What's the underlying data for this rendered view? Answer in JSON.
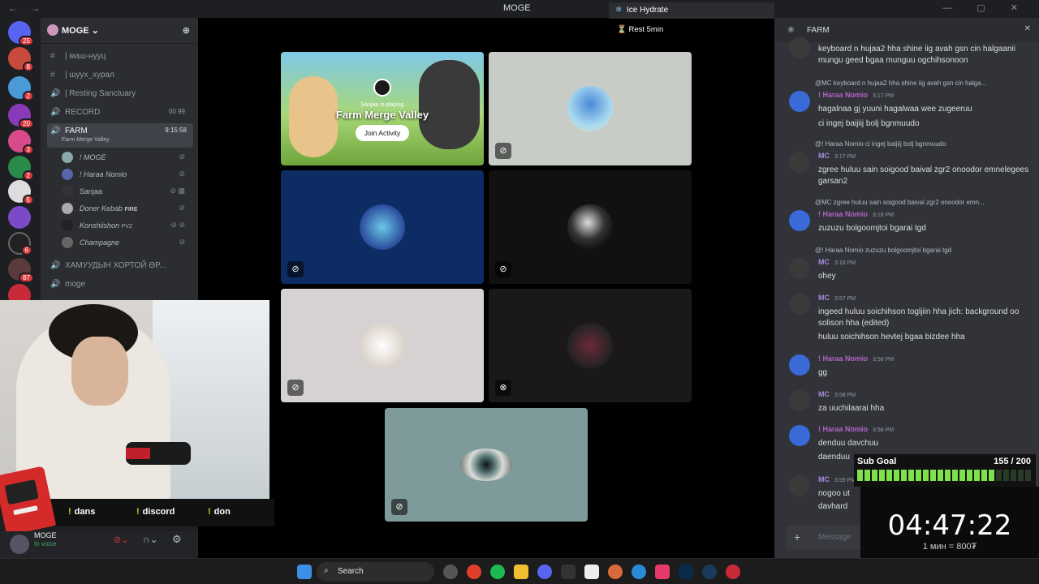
{
  "window": {
    "title": "MOGE"
  },
  "guild": {
    "name": "MOGE ⌄"
  },
  "channels": [
    {
      "label": "| маш-нууц",
      "icon": "#"
    },
    {
      "label": "| шуух_хурал",
      "icon": "#"
    },
    {
      "label": "| Resting Sanctuary",
      "icon": "🔊"
    },
    {
      "label": "RECORD",
      "icon": "🔊",
      "extra": "00  99"
    },
    {
      "label": "FARM",
      "icon": "🔊",
      "extra": "9:15:58",
      "activity": "Farm Merge Valley"
    }
  ],
  "voice_users": [
    {
      "name": "! MOGE"
    },
    {
      "name": "! Haraa Nomio"
    },
    {
      "name": "Sanjaa"
    },
    {
      "name": "Doner Kebab",
      "tag": "FIRE"
    },
    {
      "name": "Konshiishon",
      "tag": "PVZ"
    },
    {
      "name": "Champagne"
    }
  ],
  "channels_after": [
    {
      "label": "ХАМУУДЫН ХОРТОЙ ӨР...",
      "icon": "🔊"
    },
    {
      "label": "moge",
      "icon": "🔊"
    }
  ],
  "server_badges": [
    "25",
    "8",
    "2",
    "20",
    "3",
    "2",
    "5",
    "6",
    "87"
  ],
  "activity": {
    "playing": "Sanjaa is playing",
    "game": "Farm Merge Valley",
    "join": "Join Activity"
  },
  "overlay": {
    "hydrate": "Ice Hydrate",
    "rest": "Rest 5min"
  },
  "chat": {
    "channel": "FARM",
    "top_text": "keyboard n hujaa2 hha shine iig avah gsn cin halgaanii mungu geed bgaa munguu ogchihsonoon",
    "messages": [
      {
        "reply": "@MC keyboard n hujaa2 hha shine iig avah gsn cin halga...",
        "author": "! Haraa Nomio",
        "time": "3:17 PM",
        "lines": [
          "hagalnaa gj yuuni hagalwaa wee zugeeruu",
          "ci ingej baijiij bolj bgnmuudo"
        ]
      },
      {
        "reply": "@! Haraa Nomio ci ingej baijiij bolj bgnmuudo",
        "author": "MC",
        "time": "3:17 PM",
        "lines": [
          "zgree huluu sain soigood baival zgr2 onoodor emnelegees garsan2"
        ]
      },
      {
        "reply": "@MC zgree huluu sain soigood baival zgr2 onoodor emn...",
        "author": "! Haraa Nomio",
        "time": "3:18 PM",
        "lines": [
          "zuzuzu bolgoomjtoi bgarai tgd"
        ]
      },
      {
        "reply": "@! Haraa Nomio zuzuzu bolgoomjtoi bgarai tgd",
        "author": "MC",
        "time": "3:18 PM",
        "lines": [
          "ohey"
        ]
      },
      {
        "author": "MC",
        "time": "3:57 PM",
        "lines": [
          "ingeed huluu soichihson togljiin hha jich: background oo solison hha (edited)",
          "huluu soichihson hevtej bgaa bizdee hha"
        ]
      },
      {
        "author": "! Haraa Nomio",
        "time": "3:58 PM",
        "lines": [
          "gg"
        ]
      },
      {
        "author": "MC",
        "time": "3:58 PM",
        "lines": [
          "za uuchilaarai hha"
        ]
      },
      {
        "author": "! Haraa Nomio",
        "time": "3:58 PM",
        "lines": [
          "denduu davchuu",
          "daenduu"
        ]
      },
      {
        "author": "MC",
        "time": "3:59 PM",
        "lines": [
          "nogoo ut",
          "davhard"
        ]
      }
    ],
    "input_placeholder": "Message"
  },
  "stream_commands": [
    "dans",
    "discord",
    "don"
  ],
  "user_panel": {
    "name": "MOGE",
    "status": "In voice"
  },
  "sub_goal": {
    "label": "Sub Goal",
    "count": "155 / 200",
    "progress": 0.775
  },
  "timer": {
    "time": "04:47:22",
    "rate": "1 мин = 800₮"
  },
  "taskbar": {
    "search": "Search"
  },
  "colors": {
    "accent": "#5865f2",
    "goal": "#7ee04a",
    "timer_bar": "#ffe000"
  }
}
